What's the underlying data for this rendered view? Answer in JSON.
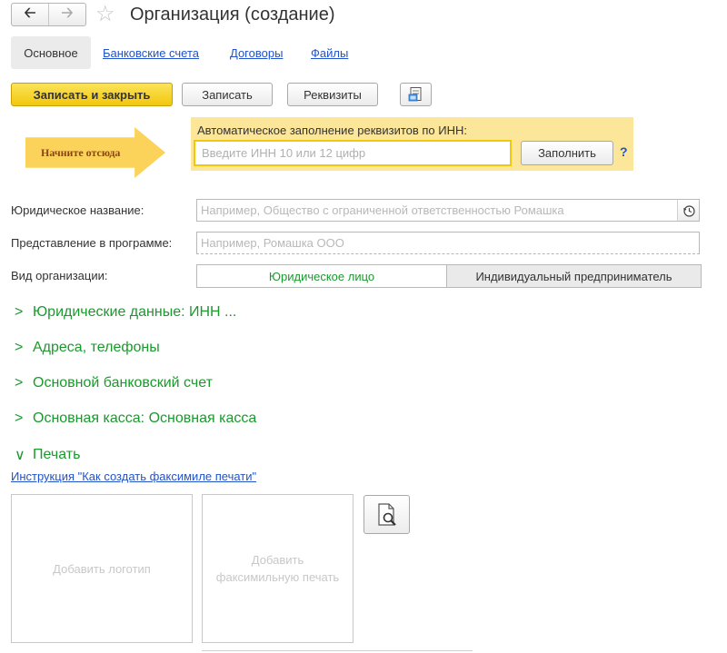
{
  "header": {
    "back_icon": "arrow-left-icon",
    "forward_icon": "arrow-right-icon",
    "favorite_icon": "star-icon",
    "title": "Организация (создание)"
  },
  "tabs": [
    {
      "label": "Основное",
      "active": true
    },
    {
      "label": "Банковские счета",
      "active": false
    },
    {
      "label": "Договоры",
      "active": false
    },
    {
      "label": "Файлы",
      "active": false
    }
  ],
  "toolbar": {
    "save_close_label": "Записать и закрыть",
    "save_label": "Записать",
    "requisites_label": "Реквизиты",
    "doc_icon": "document-icon"
  },
  "inn": {
    "label": "Автоматическое заполнение реквизитов по ИНН:",
    "placeholder": "Введите ИНН 10 или 12 цифр",
    "value": "",
    "fill_label": "Заполнить",
    "help": "?"
  },
  "hint_arrow": {
    "text": "Начните отсюда",
    "color": "#fbd35a"
  },
  "form": {
    "legal_name": {
      "label": "Юридическое название:",
      "placeholder": "Например, Общество с ограниченной ответственностью Ромашка",
      "history_icon": "history-icon"
    },
    "display_name": {
      "label": "Представление в программе:",
      "placeholder": "Например, Ромашка ООО"
    },
    "org_type": {
      "label": "Вид организации:",
      "options": [
        "Юридическое лицо",
        "Индивидуальный предприниматель"
      ],
      "selected": "Юридическое лицо"
    }
  },
  "groups": [
    {
      "label": "Юридические данные: ИНН ...",
      "expanded": false
    },
    {
      "label": "Адреса, телефоны",
      "expanded": false
    },
    {
      "label": "Основной банковский счет",
      "expanded": false
    },
    {
      "label": "Основная касса: Основная касса",
      "expanded": false
    },
    {
      "label": "Печать",
      "expanded": true
    }
  ],
  "print": {
    "instruction_link": "Инструкция \"Как создать факсимиле печати\"",
    "add_logo": "Добавить логотип",
    "add_stamp_line1": "Добавить",
    "add_stamp_line2": "факсимильную печать",
    "preview_icon": "magnifier-document-icon"
  },
  "colors": {
    "accent_green": "#1a9a2c",
    "link_blue": "#2253c8",
    "yellow_button": "#f2c70c",
    "hint_panel": "#fbe69a"
  }
}
